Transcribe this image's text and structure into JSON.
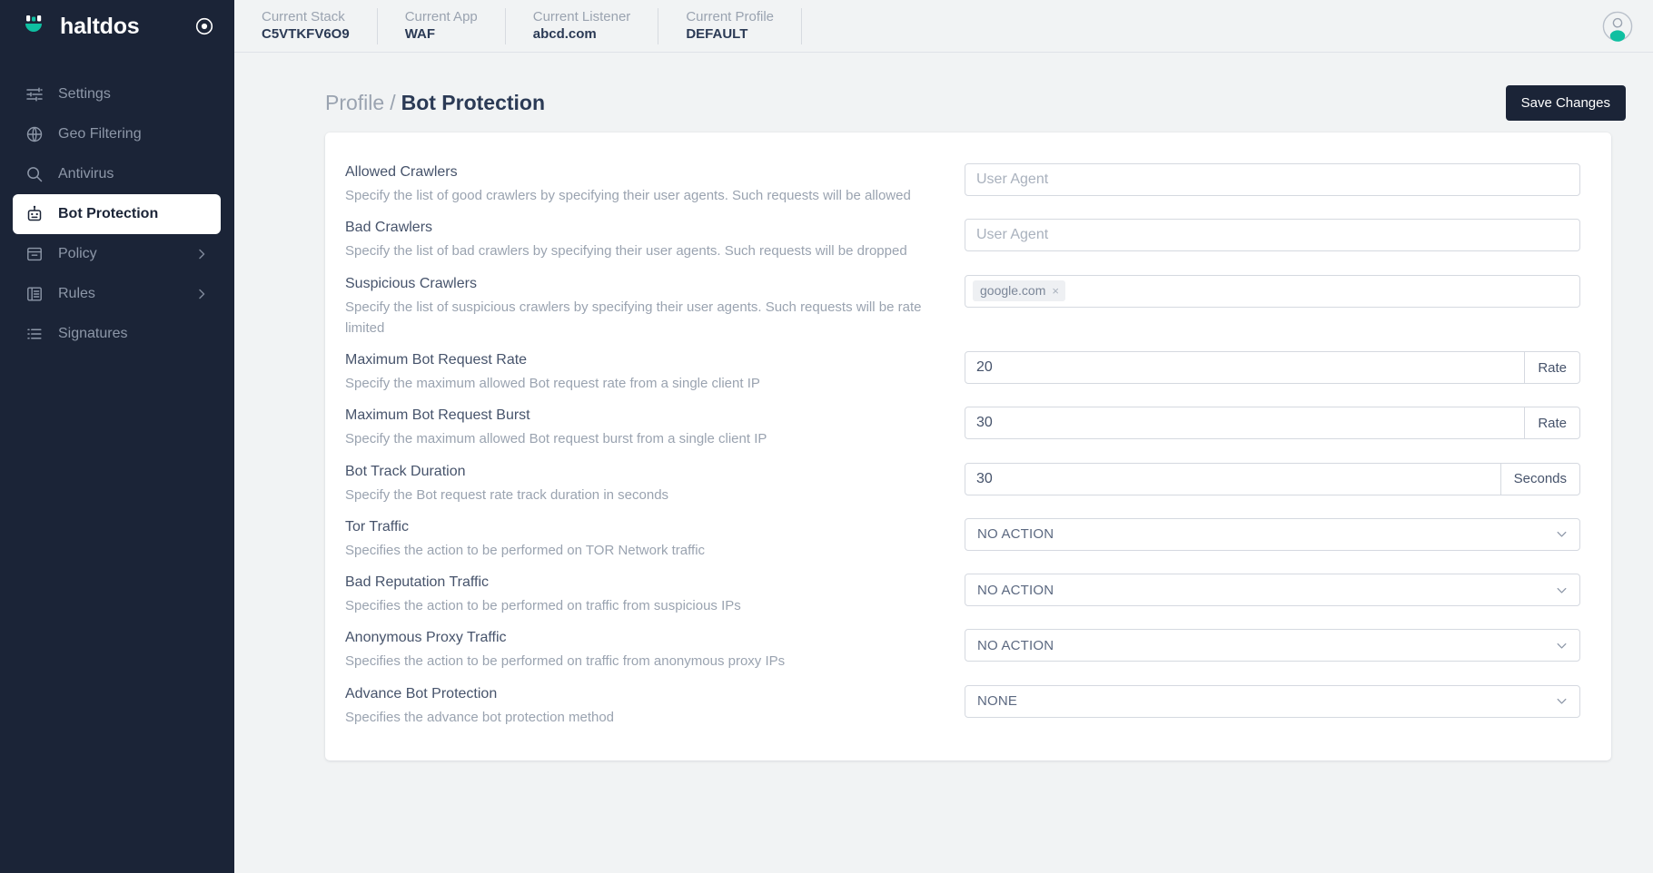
{
  "brand": {
    "name": "haltdos",
    "logo_icon": "haltdos-logo",
    "target_icon": "target-icon"
  },
  "sidebar": {
    "items": [
      {
        "label": "Settings",
        "icon": "sliders-icon",
        "active": false,
        "chevron": false
      },
      {
        "label": "Geo Filtering",
        "icon": "globe-icon",
        "active": false,
        "chevron": false
      },
      {
        "label": "Antivirus",
        "icon": "search-icon",
        "active": false,
        "chevron": false
      },
      {
        "label": "Bot Protection",
        "icon": "robot-icon",
        "active": true,
        "chevron": false
      },
      {
        "label": "Policy",
        "icon": "archive-icon",
        "active": false,
        "chevron": true
      },
      {
        "label": "Rules",
        "icon": "list-icon",
        "active": false,
        "chevron": true
      },
      {
        "label": "Signatures",
        "icon": "lines-icon",
        "active": false,
        "chevron": false
      }
    ]
  },
  "topbar": {
    "contexts": [
      {
        "label": "Current Stack",
        "value": "C5VTKFV6O9"
      },
      {
        "label": "Current App",
        "value": "WAF"
      },
      {
        "label": "Current Listener",
        "value": "abcd.com"
      },
      {
        "label": "Current Profile",
        "value": "DEFAULT"
      }
    ],
    "avatar_icon": "user-avatar"
  },
  "page": {
    "breadcrumb_parent": "Profile",
    "breadcrumb_separator": "/",
    "breadcrumb_current": "Bot Protection",
    "save_label": "Save Changes"
  },
  "form": {
    "rows": [
      {
        "title": "Allowed Crawlers",
        "desc": "Specify the list of good crawlers by specifying their user agents. Such requests will be allowed",
        "control": "input",
        "placeholder": "User Agent",
        "value": ""
      },
      {
        "title": "Bad Crawlers",
        "desc": "Specify the list of bad crawlers by specifying their user agents. Such requests will be dropped",
        "control": "input",
        "placeholder": "User Agent",
        "value": ""
      },
      {
        "title": "Suspicious Crawlers",
        "desc": "Specify the list of suspicious crawlers by specifying their user agents. Such requests will be rate limited",
        "control": "tags",
        "tags": [
          {
            "label": "google.com",
            "remove": "×"
          }
        ]
      },
      {
        "title": "Maximum Bot Request Rate",
        "desc": "Specify the maximum allowed Bot request rate from a single client IP",
        "control": "input-unit",
        "value": "20",
        "unit": "Rate"
      },
      {
        "title": "Maximum Bot Request Burst",
        "desc": "Specify the maximum allowed Bot request burst from a single client IP",
        "control": "input-unit",
        "value": "30",
        "unit": "Rate"
      },
      {
        "title": "Bot Track Duration",
        "desc": "Specify the Bot request rate track duration in seconds",
        "control": "input-unit",
        "value": "30",
        "unit": "Seconds"
      },
      {
        "title": "Tor Traffic",
        "desc": "Specifies the action to be performed on TOR Network traffic",
        "control": "select",
        "value": "NO ACTION"
      },
      {
        "title": "Bad Reputation Traffic",
        "desc": "Specifies the action to be performed on traffic from suspicious IPs",
        "control": "select",
        "value": "NO ACTION"
      },
      {
        "title": "Anonymous Proxy Traffic",
        "desc": "Specifies the action to be performed on traffic from anonymous proxy IPs",
        "control": "select",
        "value": "NO ACTION"
      },
      {
        "title": "Advance Bot Protection",
        "desc": "Specifies the advance bot protection method",
        "control": "select",
        "value": "NONE"
      }
    ]
  },
  "colors": {
    "sidebar_bg": "#1b2437",
    "accent_teal": "#0fbfa1",
    "page_bg": "#f1f3f4",
    "text_dark": "#2b3a55",
    "text_muted": "#9aa3b0"
  }
}
